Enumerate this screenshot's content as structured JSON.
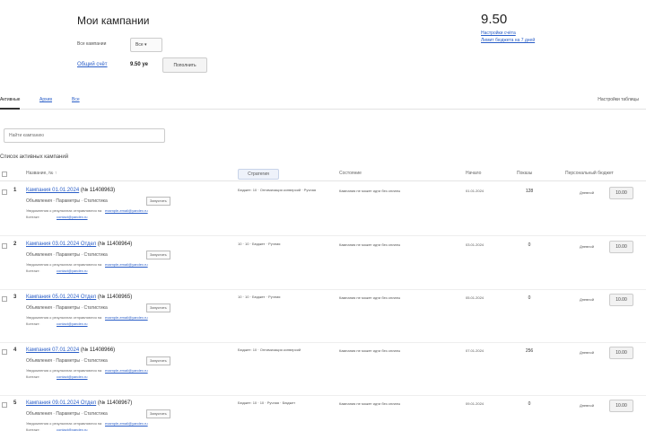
{
  "header": {
    "title": "Мои кампании",
    "filter_label": "Все кампании",
    "filter_value": "Все",
    "total_link": "Общий счёт",
    "total_value": "9.50 уе",
    "total_button": "Пополнить",
    "budget_value": "9.50",
    "budget_link1": "Настройки счёта",
    "budget_link2": "Лимит бюджета на 7 дней"
  },
  "tabs": {
    "items": [
      "Активные",
      "Архив",
      "Все"
    ],
    "settings": "Настройки таблицы"
  },
  "search": {
    "placeholder": "Найти кампанию"
  },
  "section_title": "Список активных кампаний",
  "table": {
    "columns": {
      "name": "Название, № ↑",
      "strategy": "Стратегия",
      "status": "Состояние",
      "date": "Начало",
      "count": "Показы",
      "budget": "Персональный бюджет"
    },
    "rows": [
      {
        "num": "1",
        "name": "Кампания 01.01.2024",
        "id": "(№ 11408963)",
        "actions": "Объявления · Параметры · Статистика",
        "badge": "Запустить",
        "note": "Уведомления о результатах отправляются на",
        "email": "example-email@yandex.ru",
        "note2": "Контакт:",
        "email2": "contact@yandex.ru",
        "strategy": "Бюджет: 10 · Оптимизация конверсий · Ручная",
        "status": "Кампания не может идти без оплаты",
        "date": "01.01.2024",
        "count": "128",
        "budget_word": "Дневной",
        "budget_btn": "10.00"
      },
      {
        "num": "2",
        "name": "Кампания 03.01.2024 Отдел",
        "id": "(№ 11408964)",
        "actions": "Объявления · Параметры · Статистика",
        "badge": "Запустить",
        "note": "Уведомления о результатах отправляются на",
        "email": "example-email@yandex.ru",
        "note2": "Контакт:",
        "email2": "contact@yandex.ru",
        "strategy": "10 · 10 · Бюджет · Ручная",
        "status": "Кампания не может идти без оплаты",
        "date": "03.01.2024",
        "count": "0",
        "budget_word": "Дневной",
        "budget_btn": "10.00"
      },
      {
        "num": "3",
        "name": "Кампания 05.01.2024 Отдел",
        "id": "(№ 11408965)",
        "actions": "Объявления · Параметры · Статистика",
        "badge": "Запустить",
        "note": "Уведомления о результатах отправляются на",
        "email": "example-email@yandex.ru",
        "note2": "Контакт:",
        "email2": "contact@yandex.ru",
        "strategy": "10 · 10 · Бюджет · Ручная",
        "status": "Кампания не может идти без оплаты",
        "date": "05.01.2024",
        "count": "0",
        "budget_word": "Дневной",
        "budget_btn": "10.00"
      },
      {
        "num": "4",
        "name": "Кампания 07.01.2024",
        "id": "(№ 11408966)",
        "actions": "Объявления · Параметры · Статистика",
        "badge": "Запустить",
        "note": "Уведомления о результатах отправляются на",
        "email": "example-email@yandex.ru",
        "note2": "Контакт:",
        "email2": "contact@yandex.ru",
        "strategy": "Бюджет: 10 · Оптимизация конверсий",
        "status": "Кампания не может идти без оплаты",
        "date": "07.01.2024",
        "count": "256",
        "budget_word": "Дневной",
        "budget_btn": "10.00"
      },
      {
        "num": "5",
        "name": "Кампания 09.01.2024 Отдел",
        "id": "(№ 11408967)",
        "actions": "Объявления · Параметры · Статистика",
        "badge": "Запустить",
        "note": "Уведомления о результатах отправляются на",
        "email": "example-email@yandex.ru",
        "note2": "Контакт:",
        "email2": "contact@yandex.ru",
        "strategy": "Бюджет: 10 · 10 · Ручная · Бюджет",
        "status": "Кампания не может идти без оплаты",
        "date": "09.01.2024",
        "count": "0",
        "budget_word": "Дневной",
        "budget_btn": "10.00"
      }
    ]
  }
}
